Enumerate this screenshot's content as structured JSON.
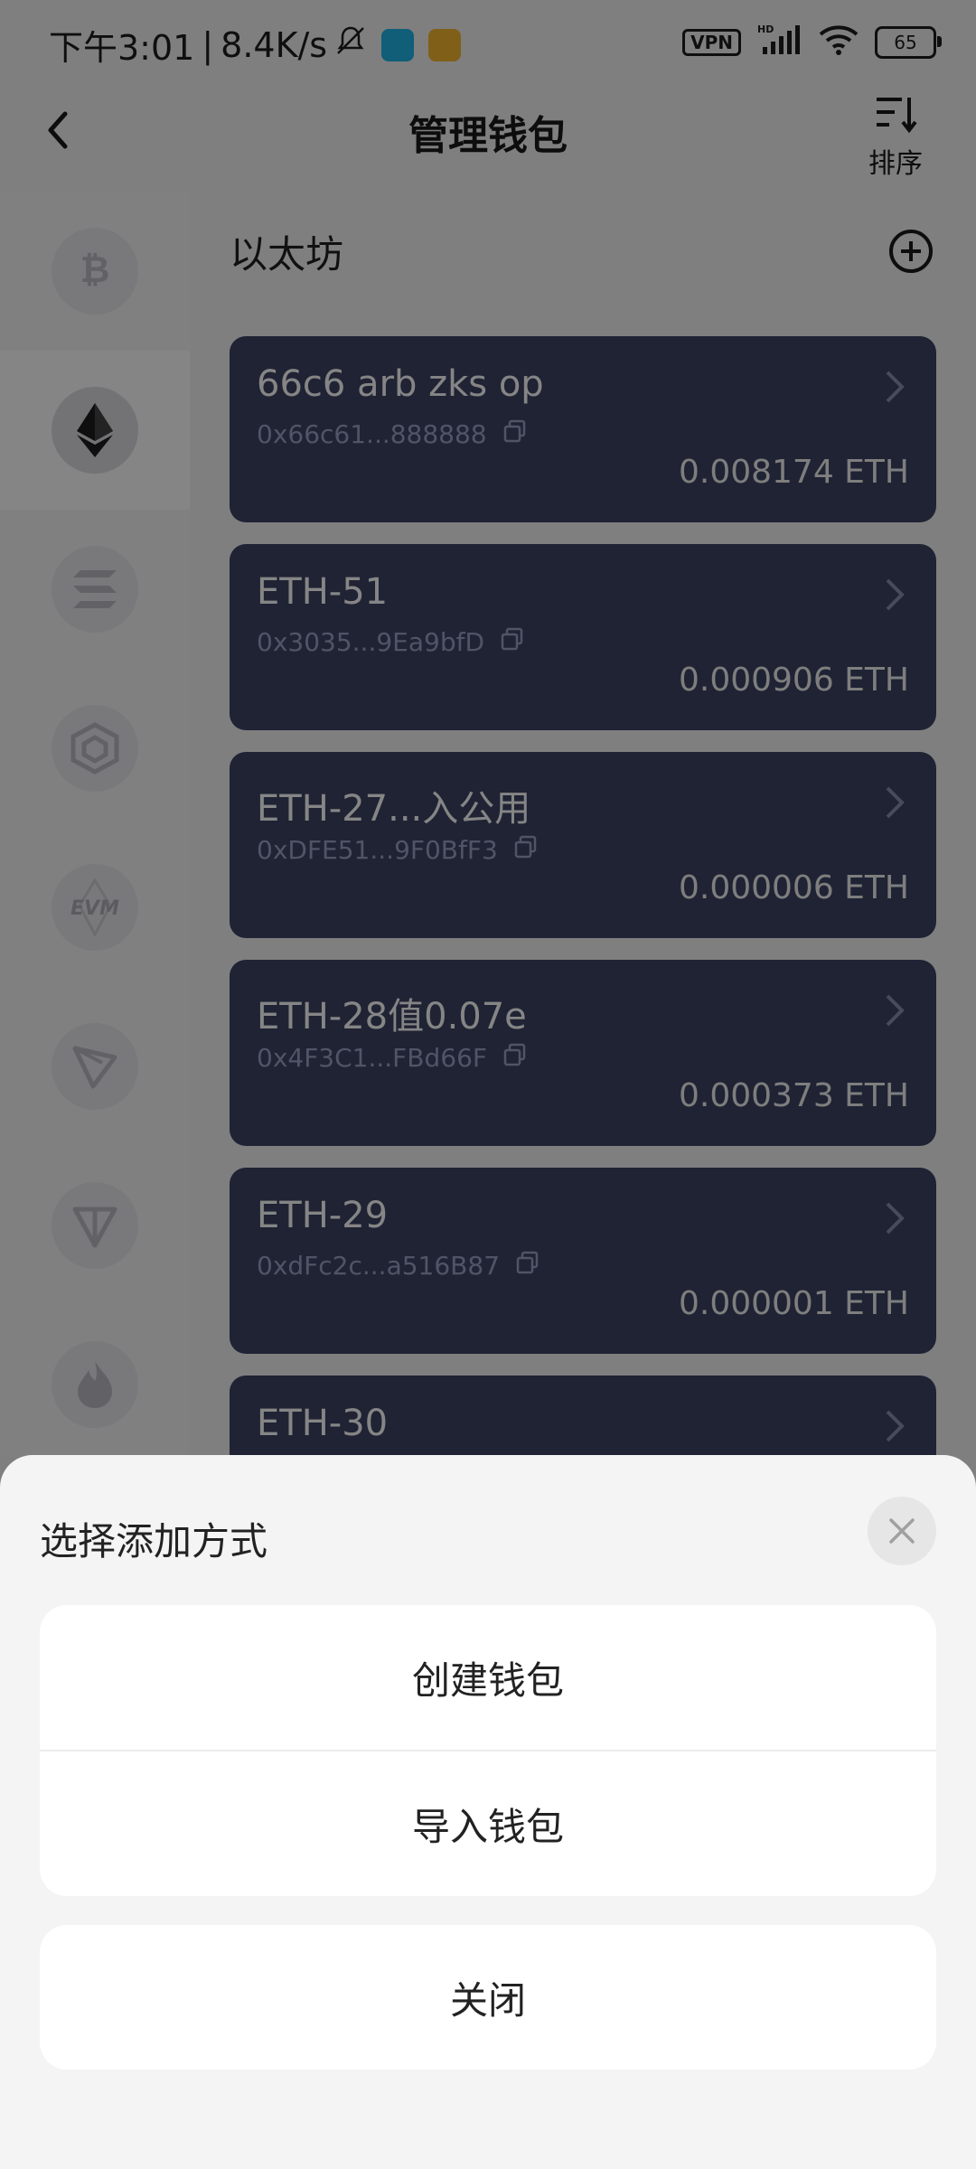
{
  "status_bar": {
    "time": "下午3:01",
    "speed": "8.4K/s",
    "vpn": "VPN",
    "hd": "HD",
    "battery": "65"
  },
  "header": {
    "title": "管理钱包",
    "sort_label": "排序"
  },
  "section": {
    "title": "以太坊"
  },
  "wallets": [
    {
      "name": "66c6 arb zks op",
      "address": "0x66c61...888888",
      "balance": "0.008174 ETH"
    },
    {
      "name": "ETH-51",
      "address": "0x3035...9Ea9bfD",
      "balance": "0.000906 ETH"
    },
    {
      "name": "ETH-27...入公用",
      "address": "0xDFE51...9F0BfF3",
      "balance": "0.000006 ETH"
    },
    {
      "name": "ETH-28值0.07e",
      "address": "0x4F3C1...FBd66F",
      "balance": "0.000373 ETH"
    },
    {
      "name": "ETH-29",
      "address": "0xdFc2c...a516B87",
      "balance": "0.000001 ETH"
    },
    {
      "name": "ETH-30",
      "address": "",
      "balance": ""
    }
  ],
  "sidebar_chains": [
    "bitcoin-icon",
    "ethereum-icon",
    "solana-icon",
    "bnb-icon",
    "evm-icon",
    "tron-icon",
    "ton-icon",
    "fire-icon"
  ],
  "evm_text": "EVM",
  "sheet": {
    "title": "选择添加方式",
    "option_create": "创建钱包",
    "option_import": "导入钱包",
    "close_label": "关闭"
  },
  "colors": {
    "card_bg": "#3d4364",
    "overlay": "rgba(0,0,0,0.48)",
    "sheet_bg": "#f4f4f4"
  }
}
